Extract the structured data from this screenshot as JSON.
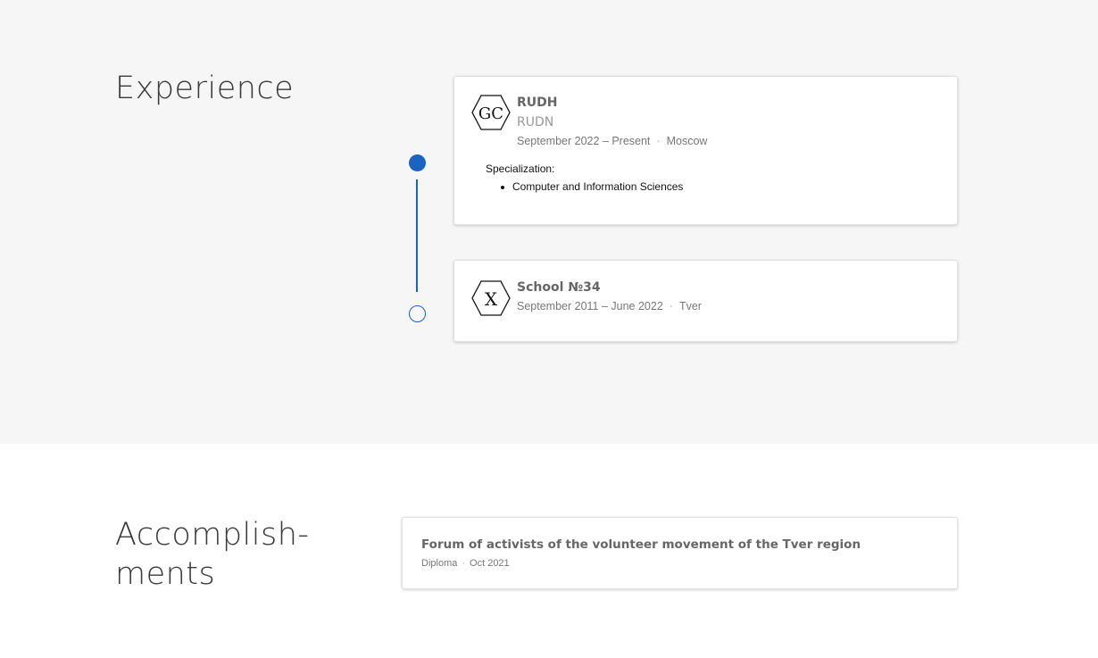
{
  "experience": {
    "title": "Experience",
    "items": [
      {
        "logo_text": "GC",
        "org": "RUDH",
        "subtitle": "RUDN",
        "dates": "September 2022 – Present",
        "location": "Moscow",
        "spec_label": "Specialization:",
        "specializations": [
          "Computer and Information Sciences"
        ],
        "current": true
      },
      {
        "logo_text": "X",
        "org": "School №34",
        "dates": "September 2011 – June 2022",
        "location": "Tver",
        "current": false
      }
    ]
  },
  "accomplishments": {
    "title": "Accomplish-\nments",
    "title_line1": "Accomplish-",
    "title_line2": "ments",
    "items": [
      {
        "name": "Forum of activists of the volunteer movement of the Tver region",
        "type": "Diploma",
        "date": "Oct 2021"
      }
    ]
  },
  "colors": {
    "accent": "#1a63c0",
    "section_bg": "#f6f6f6"
  },
  "separator": "·"
}
